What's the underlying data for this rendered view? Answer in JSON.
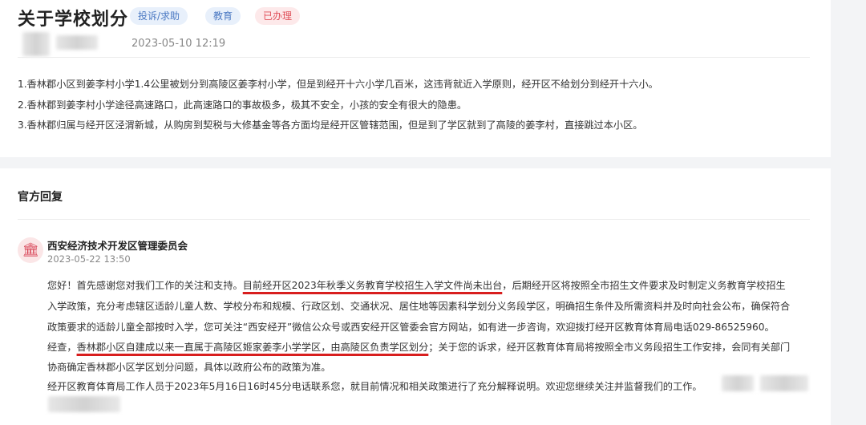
{
  "post": {
    "title": "关于学校划分",
    "tags": [
      "投诉/求助",
      "教育",
      "已办理"
    ],
    "date": "2023-05-10 12:19",
    "content": [
      "1.香林郡小区到姜李村小学1.4公里被划分到高陵区姜李村小学，但是到经开十六小学几百米，这违背就近入学原则，经开区不给划分到经开十六小。",
      "2.香林郡到姜李村小学途径高速路口，此高速路口的事故极多，极其不安全，小孩的安全有很大的隐患。",
      "3.香林郡归属与经开区泾渭新城，从购房到契税与大修基金等各方面均是经开区管辖范围，但是到了学区就到了高陵的姜李村，直接跳过本小区。"
    ]
  },
  "reply": {
    "section_title": "官方回复",
    "org_icon": "government-building-icon",
    "org_icon_glyph": "🏛",
    "org_name": "西安经济技术开发区管理委员会",
    "date": "2023-05-22 13:50",
    "line1_a": "您好！首先感谢您对我们工作的关注和支持。",
    "line1_b": "目前经开区2023年秋季义务教育学校招生入学文件尚未出台",
    "line1_c": "，后期经开区将按照全市招生文件要求及时制定义务教育学校招生",
    "line2": "入学政策，充分考虑辖区适龄儿童人数、学校分布和规模、行政区划、交通状况、居住地等因素科学划分义务段学区，明确招生条件及所需资料并及时向社会公布，确保符合",
    "line3": "政策要求的适龄儿童全部按时入学，您可关注“西安经开”微信公众号或西安经开区管委会官方网站，如有进一步咨询，欢迎拨打经开区教育体育局电话029-86525960。",
    "line4_a": "经查，",
    "line4_b": "香林郡小区自建成以来一直属于高陵区姬家姜李小学学区，由高陵区负责学区划分",
    "line4_c": "；关于您的诉求，经开区教育体育局将按照全市义务段招生工作安排，会同有关部门",
    "line5": "协商确定香林郡小区学区划分问题，具体以政府公布的政策为准。",
    "line6": "经开区教育体育局工作人员于2023年5月16日16时45分电话联系您，就目前情况和相关政策进行了充分解释说明。欢迎您继续关注并监督我们的工作。"
  },
  "colors": {
    "tag_blue_text": "#4a78c2",
    "tag_red_text": "#e0505a",
    "underline": "#d81e1e"
  }
}
